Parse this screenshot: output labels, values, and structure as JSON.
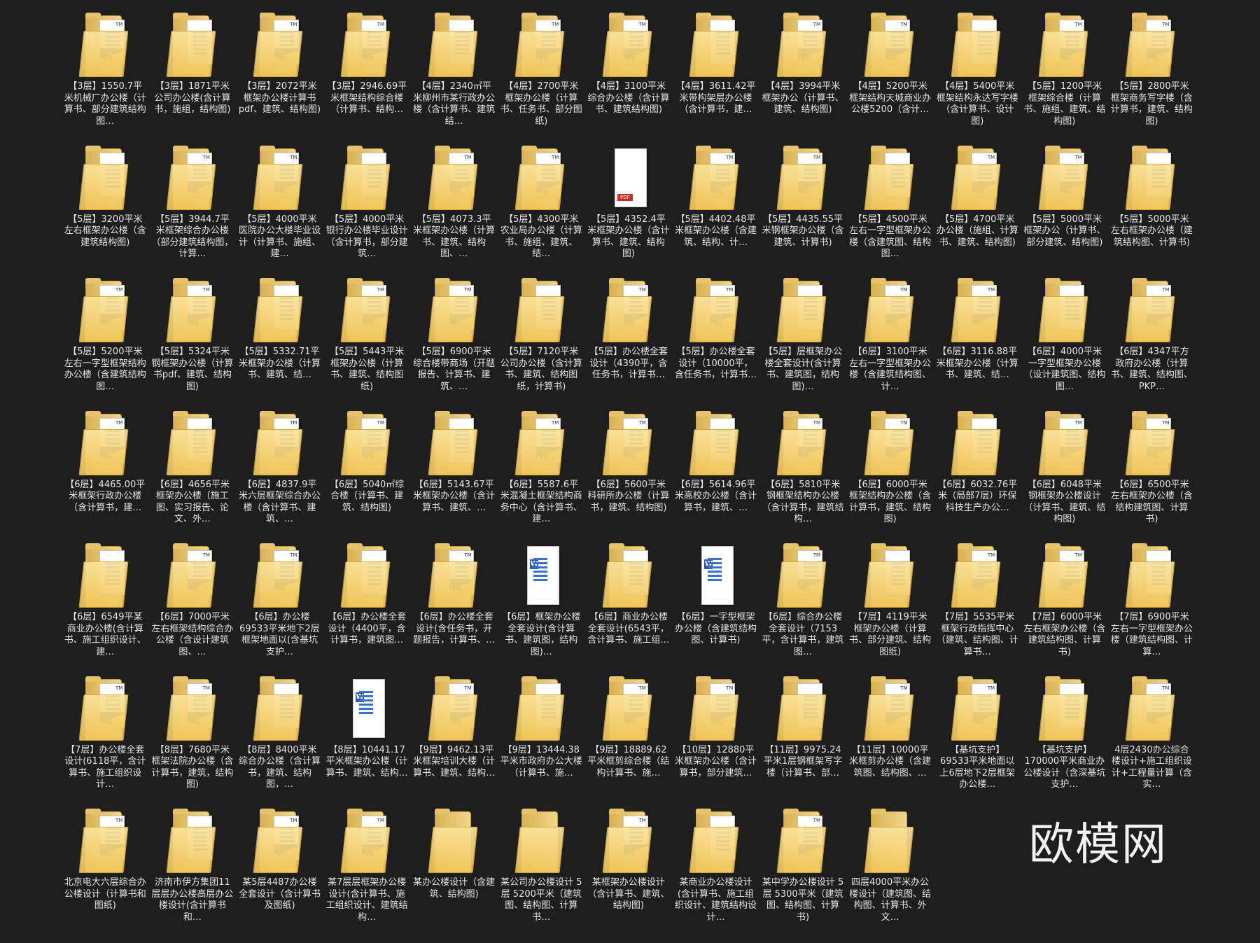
{
  "brand": "欧模网",
  "items": [
    {
      "label": "【3层】1550.7平米机械厂办公楼（计算书、部分建筑结构图…",
      "icon": "folder-doc-icon"
    },
    {
      "label": "【3层】1871平米公司办公楼(含计算书，施组，结构图)",
      "icon": "folder-doc-icon"
    },
    {
      "label": "【3层】2072平米框架办公楼计算书pdf、建筑、结构图)",
      "icon": "folder-doc-icon"
    },
    {
      "label": "【3层】2946.69平米框架结构综合楼（计算书、结构…",
      "icon": "folder-doc-icon"
    },
    {
      "label": "【4层】2340㎡平米柳州市某行政办公楼（含计算书、建筑结…",
      "icon": "folder-doc-icon"
    },
    {
      "label": "【4层】2700平米框架办公楼（计算书、任务书、部分图纸)",
      "icon": "folder-doc-icon"
    },
    {
      "label": "【4层】3100平米综合办公楼（含计算书、建筑结构图)",
      "icon": "folder-doc-icon"
    },
    {
      "label": "【4层】3611.42平米带构架层办公楼（含计算书，建…",
      "icon": "folder-doc-icon"
    },
    {
      "label": "【4层】3994平米框架办公（计算书、建筑、结构图)",
      "icon": "folder-doc-icon"
    },
    {
      "label": "【4层】5200平米框架结构天城商业办公楼5200（含计…",
      "icon": "folder-doc-icon"
    },
    {
      "label": "【4层】5400平米框架结构永达写字楼（含计算书、设计图)",
      "icon": "folder-doc-icon"
    },
    {
      "label": "【5层】1200平米框架综合楼（计算书、施组、建筑、结构图)",
      "icon": "folder-doc-icon"
    },
    {
      "label": "【5层】2800平米框架商务写字楼（含计算书，建筑、结构图)",
      "icon": "folder-doc-icon"
    },
    {
      "label": "【5层】3200平米左右框架办公楼（含建筑结构图)",
      "icon": "folder-doc-icon"
    },
    {
      "label": "【5层】3944.7平米框架综合办公楼（部分建筑结构图，计算…",
      "icon": "folder-doc-icon"
    },
    {
      "label": "【5层】4000平米医院办公大楼毕业设计（计算书、施组、建…",
      "icon": "folder-doc-icon"
    },
    {
      "label": "【5层】4000平米银行办公楼毕业设计（含计算书，部分建筑…",
      "icon": "folder-doc-icon"
    },
    {
      "label": "【5层】4073.3平米框架办公楼（计算书、建筑、结构图、…",
      "icon": "folder-doc-icon"
    },
    {
      "label": "【5层】4300平米农业局办公楼（计算书、施组、建筑、结…",
      "icon": "folder-doc-icon"
    },
    {
      "label": "【5层】4352.4平米框架办公楼（含计算书、建筑、结构图)",
      "icon": "pdf-file-icon"
    },
    {
      "label": "【5层】4402.48平米框架办公楼（含建筑、结构、计…",
      "icon": "folder-doc-icon"
    },
    {
      "label": "【5层】4435.55平米钢框架办公楼（含建筑、计算书)",
      "icon": "folder-doc-icon"
    },
    {
      "label": "【5层】4500平米左右一字型框架办公楼（含建筑图、结构图…",
      "icon": "folder-doc-icon"
    },
    {
      "label": "【5层】4700平米办公楼（施组、计算书、建筑、结构图)",
      "icon": "folder-doc-icon"
    },
    {
      "label": "【5层】5000平米框架办公（计算书、部分建筑、结构图)",
      "icon": "folder-doc-icon"
    },
    {
      "label": "【5层】5000平米左右框架办公楼（建筑结构图、计算书)",
      "icon": "folder-doc-icon"
    },
    {
      "label": "【5层】5200平米左右一字型框架结构办公楼（含建筑结构图…",
      "icon": "folder-doc-icon"
    },
    {
      "label": "【5层】5324平米钢框架办公楼（计算书pdf、建筑、结构图)",
      "icon": "folder-doc-icon"
    },
    {
      "label": "【5层】5332.71平米框架办公楼（计算书、建筑、结…",
      "icon": "folder-doc-icon"
    },
    {
      "label": "【5层】5443平米框架办公楼（计算书、建筑、结构图纸)",
      "icon": "folder-doc-icon"
    },
    {
      "label": "【5层】6900平米综合楼带商场（开题报告、计算书、建筑、…",
      "icon": "folder-doc-icon"
    },
    {
      "label": "【5层】7120平米公司办公楼（含计算书、建筑、结构图纸，计算书)",
      "icon": "folder-doc-icon"
    },
    {
      "label": "【5层】办公楼全套设计（4390平，含任务书，计算书…",
      "icon": "folder-doc-icon"
    },
    {
      "label": "【5层】办公楼全套设计（10000平，含任务书，计算书…",
      "icon": "folder-doc-icon"
    },
    {
      "label": "【5层】层框架办公楼全套设计(含计算书、建筑图，结构图)…",
      "icon": "folder-doc-icon"
    },
    {
      "label": "【6层】3100平米左右一字型框架办公楼（含建筑结构图、计…",
      "icon": "folder-doc-icon"
    },
    {
      "label": "【6层】3116.88平米框架办公楼（计算书、建筑、结…",
      "icon": "folder-doc-icon"
    },
    {
      "label": "【6层】4000平米一字型框架办公楼（设计建筑图、结构图…",
      "icon": "folder-doc-icon"
    },
    {
      "label": "【6层】4347平方政府办公楼（计算书、建筑、结构图、PKP…",
      "icon": "folder-doc-icon"
    },
    {
      "label": "【6层】4465.00平米框架行政办公楼（含计算书，建…",
      "icon": "folder-doc-icon"
    },
    {
      "label": "【6层】4656平米框架办公楼（施工图、实习报告、论文、外…",
      "icon": "folder-doc-icon"
    },
    {
      "label": "【6层】4837.9平米六层框架综合办公楼（含计算书、建筑、…",
      "icon": "folder-doc-icon"
    },
    {
      "label": "【6层】5040㎡综合楼（计算书、建筑、结构图)",
      "icon": "folder-doc-icon"
    },
    {
      "label": "【6层】5143.67平米框架办公楼（含计算书、建筑、…",
      "icon": "folder-doc-icon"
    },
    {
      "label": "【6层】5587.6平米混凝土框架结构商务中心（含计算书、建…",
      "icon": "folder-doc-icon"
    },
    {
      "label": "【6层】5600平米科研所办公楼（计算书，建筑、结构图)",
      "icon": "folder-doc-icon"
    },
    {
      "label": "【6层】5614.96平米高校办公楼（含计算书，建筑、…",
      "icon": "folder-doc-icon"
    },
    {
      "label": "【6层】5810平米钢框架结构办公楼（含计算书，建筑结构…",
      "icon": "folder-doc-icon"
    },
    {
      "label": "【6层】6000平米框架结构办公楼（含计算书，建筑、结构图)",
      "icon": "folder-doc-icon"
    },
    {
      "label": "【6层】6032.76平米（局部7层）环保科技生产办公…",
      "icon": "folder-doc-icon"
    },
    {
      "label": "【6层】6048平米钢框架办公楼设计（计算书、建筑、结构图)",
      "icon": "folder-doc-icon"
    },
    {
      "label": "【6层】6500平米左右框架办公楼（含结构建筑图、计算书)",
      "icon": "folder-doc-icon"
    },
    {
      "label": "【6层】6549平某商业办公楼(含计算书、施工组织设计、建…",
      "icon": "folder-doc-icon"
    },
    {
      "label": "【6层】7000平米左右框架结构综合办公楼（含设计建筑图、…",
      "icon": "folder-doc-icon"
    },
    {
      "label": "【6层】办公楼69533平米地下2层框架地面以(含基坑支护…",
      "icon": "folder-doc-icon"
    },
    {
      "label": "【6层】办公楼全套设计（4400平，含计算书，建筑图…",
      "icon": "folder-doc-icon"
    },
    {
      "label": "【6层】办公楼全套设计(含任务书，开题报告，计算书、…",
      "icon": "folder-doc-icon"
    },
    {
      "label": "【6层】框架办公楼全套设计(含计算书、建筑图，结构图)…",
      "icon": "word-file-icon"
    },
    {
      "label": "【6层】商业办公楼全套设计(6543平，含计算书、施工组…",
      "icon": "folder-doc-icon"
    },
    {
      "label": "【6层】一字型框架办公楼（含建筑结构图、计算书)",
      "icon": "word-file-icon"
    },
    {
      "label": "【6层】综合办公楼全套设计（7153平，含计算书，建筑图…",
      "icon": "folder-doc-icon"
    },
    {
      "label": "【7层】4119平米框架办公楼（计算书、部分建筑、结构图纸)",
      "icon": "folder-doc-icon"
    },
    {
      "label": "【7层】5535平米框架行政指挥中心（建筑、结构图、计算书…",
      "icon": "folder-doc-icon"
    },
    {
      "label": "【7层】6000平米左右框架办公楼（含建筑结构图、计算书)",
      "icon": "folder-doc-icon"
    },
    {
      "label": "【7层】6900平米左右一字型框架办公楼（建筑结构图、计算…",
      "icon": "folder-doc-icon"
    },
    {
      "label": "【7层】办公楼全套设计(6118平，含计算书、施工组织设计…",
      "icon": "folder-doc-icon"
    },
    {
      "label": "【8层】7680平米框架法院办公楼（含计算书，建筑，结构图)",
      "icon": "folder-doc-icon"
    },
    {
      "label": "【8层】8400平米综合办公楼（含计算书，建筑、结构图，…",
      "icon": "folder-doc-icon"
    },
    {
      "label": "【8层】10441.17平米框架办公楼（计算书、建筑、结构…",
      "icon": "word-file-icon"
    },
    {
      "label": "【9层】9462.13平米框架培训大楼（计算书、建筑、结构…",
      "icon": "folder-doc-icon"
    },
    {
      "label": "【9层】13444.38平米市政府办公大楼（计算书、施…",
      "icon": "folder-doc-icon"
    },
    {
      "label": "【9层】18889.62平米框剪综合楼（结构计算书、施…",
      "icon": "folder-doc-icon"
    },
    {
      "label": "【10层】12880平米框架办公楼（含计算书，部分建筑…",
      "icon": "folder-doc-icon"
    },
    {
      "label": "【11层】9975.24平米1层钢框架写字楼（计算书、部…",
      "icon": "folder-doc-icon"
    },
    {
      "label": "【11层】10000平米框剪办公楼（含建筑图、结构图、…",
      "icon": "folder-doc-icon"
    },
    {
      "label": "【基坑支护】69533平米地面以上6层地下2层框架办公楼…",
      "icon": "folder-doc-icon"
    },
    {
      "label": "【基坑支护】170000平米商业办公楼设计（含深基坑支护…",
      "icon": "folder-doc-icon"
    },
    {
      "label": "4层2430办公综合楼设计+施工组织设计+工程量计算（含实…",
      "icon": "folder-doc-icon"
    },
    {
      "label": "北京电大六层综合办公楼设计（计算书和图纸)",
      "icon": "folder-doc-icon"
    },
    {
      "label": "济南市伊方集团11层层办公楼高层办公楼设计(含计算书和…",
      "icon": "folder-doc-icon"
    },
    {
      "label": "某5层4487办公楼全套设计（含计算书及图纸)",
      "icon": "folder-doc-icon"
    },
    {
      "label": "某7层层框架办公楼设计(含计算书、施工组织设计、建筑结构…",
      "icon": "folder-doc-icon"
    },
    {
      "label": "某办公楼设计（含建筑、结构图)",
      "icon": "folder-icon"
    },
    {
      "label": "某公司办公楼设计 5层 5200平米（建筑图、结构图、计算书…",
      "icon": "folder-icon"
    },
    {
      "label": "某框架办公楼设计（含计算书、建筑、结构图)",
      "icon": "folder-doc-icon"
    },
    {
      "label": "某商业办公楼设计(含计算书、施工组织设计、建筑结构设计…",
      "icon": "folder-doc-icon"
    },
    {
      "label": "某中学办公楼设计 5层 5300平米（建筑图、结构图、计算书)",
      "icon": "folder-doc-icon"
    },
    {
      "label": "四层4000平米办公楼设计（建筑图、结构图、计算书、外文…",
      "icon": "folder-icon"
    }
  ]
}
